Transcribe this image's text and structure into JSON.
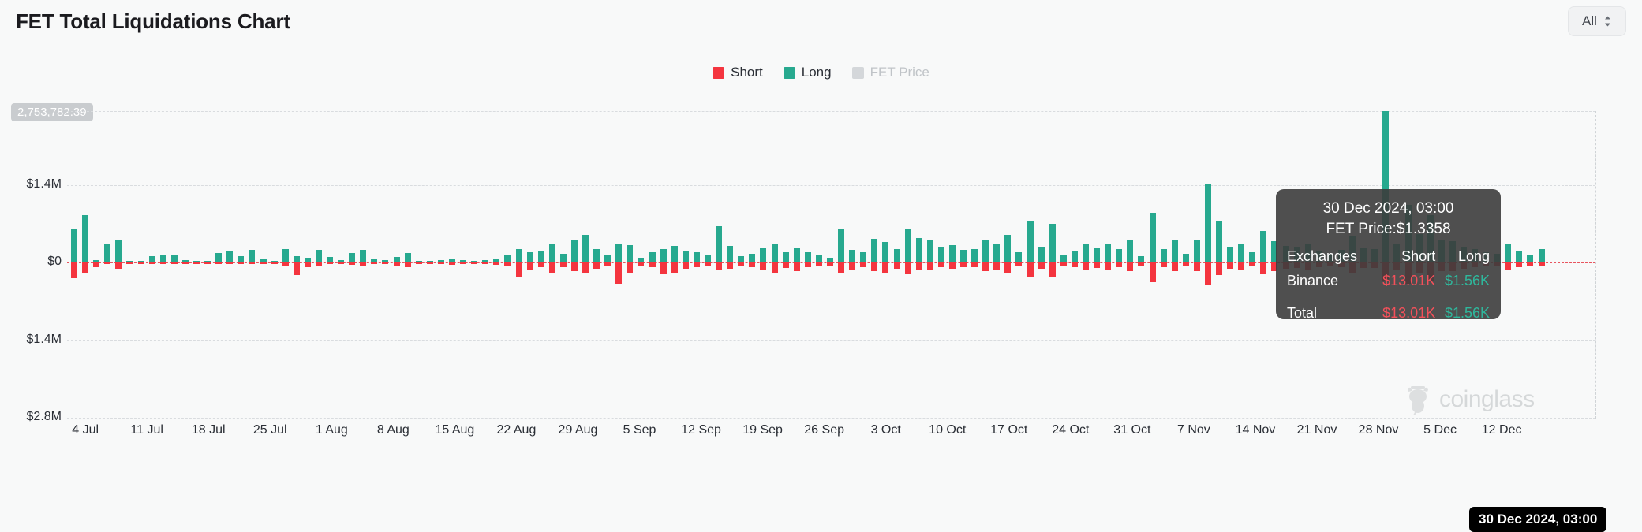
{
  "header": {
    "title": "FET Total Liquidations Chart",
    "range_selector": {
      "value": "All",
      "icon": "stepper-icon"
    }
  },
  "legend": [
    {
      "label": "Short",
      "color": "#f4353f",
      "disabled": false
    },
    {
      "label": "Long",
      "color": "#27a98f",
      "disabled": false
    },
    {
      "label": "FET Price",
      "color": "#d4d7da",
      "disabled": true
    }
  ],
  "y_badge": "2,753,782.39",
  "watermark": "coinglass",
  "crosshair_label": "30 Dec 2024, 03:00",
  "tooltip": {
    "date": "30 Dec 2024, 03:00",
    "price_line": "FET Price:$1.3358",
    "columns": [
      "Exchanges",
      "Short",
      "Long"
    ],
    "rows": [
      {
        "exchange": "Binance",
        "short": "$13.01K",
        "long": "$1.56K"
      },
      {
        "exchange": "Total",
        "short": "$13.01K",
        "long": "$1.56K"
      }
    ]
  },
  "chart_data": {
    "type": "bar",
    "title": "FET Total Liquidations Chart",
    "xlabel": "",
    "ylabel": "",
    "stacked": true,
    "grid": true,
    "legend_position": "top-center",
    "ylim": [
      -2800000,
      2753782.39
    ],
    "yticks": [
      1400000,
      0,
      -1400000,
      -2800000
    ],
    "ytick_labels": [
      "$1.4M",
      "$0",
      "$1.4M",
      "$2.8M"
    ],
    "ytop_annotation": "2,753,782.39",
    "xticks": [
      "4 Jul",
      "11 Jul",
      "18 Jul",
      "25 Jul",
      "1 Aug",
      "8 Aug",
      "15 Aug",
      "22 Aug",
      "29 Aug",
      "5 Sep",
      "12 Sep",
      "19 Sep",
      "26 Sep",
      "3 Oct",
      "10 Oct",
      "17 Oct",
      "24 Oct",
      "31 Oct",
      "7 Nov",
      "14 Nov",
      "21 Nov",
      "28 Nov",
      "5 Dec",
      "12 Dec"
    ],
    "series": [
      {
        "name": "Long",
        "color": "#27a98f",
        "values": [
          620000,
          860000,
          40000,
          330000,
          400000,
          18000,
          10000,
          120000,
          150000,
          130000,
          40000,
          20000,
          25000,
          170000,
          200000,
          110000,
          230000,
          60000,
          30000,
          250000,
          120000,
          80000,
          230000,
          100000,
          40000,
          170000,
          230000,
          60000,
          50000,
          100000,
          170000,
          30000,
          25000,
          40000,
          60000,
          50000,
          35000,
          40000,
          60000,
          130000,
          240000,
          180000,
          220000,
          330000,
          160000,
          420000,
          500000,
          250000,
          140000,
          330000,
          320000,
          90000,
          180000,
          240000,
          300000,
          210000,
          180000,
          130000,
          660000,
          300000,
          120000,
          160000,
          260000,
          330000,
          190000,
          260000,
          180000,
          140000,
          90000,
          610000,
          230000,
          180000,
          430000,
          380000,
          250000,
          600000,
          440000,
          410000,
          280000,
          320000,
          230000,
          240000,
          410000,
          330000,
          500000,
          190000,
          750000,
          290000,
          700000,
          150000,
          200000,
          340000,
          260000,
          330000,
          240000,
          420000,
          120000,
          900000,
          240000,
          420000,
          160000,
          420000,
          1420000,
          760000,
          280000,
          330000,
          180000,
          570000,
          390000,
          300000,
          270000,
          350000,
          210000,
          160000,
          230000,
          480000,
          260000,
          250000,
          2753782,
          330000,
          1050000,
          520000,
          860000,
          410000,
          390000,
          290000,
          240000,
          180000,
          160000,
          330000,
          210000,
          140000,
          240000
        ]
      },
      {
        "name": "Short",
        "color": "#f4353f",
        "values": [
          -290000,
          -180000,
          -90000,
          -20000,
          -120000,
          -15000,
          -10000,
          -18000,
          -15000,
          -14000,
          -12000,
          -10000,
          -8000,
          -20000,
          -16000,
          -12000,
          -30000,
          -10000,
          -8000,
          -60000,
          -230000,
          -90000,
          -60000,
          -30000,
          -20000,
          -40000,
          -70000,
          -30000,
          -25000,
          -60000,
          -90000,
          -20000,
          -18000,
          -30000,
          -40000,
          -30000,
          -25000,
          -30000,
          -40000,
          -60000,
          -250000,
          -140000,
          -90000,
          -180000,
          -80000,
          -160000,
          -200000,
          -120000,
          -60000,
          -390000,
          -180000,
          -50000,
          -90000,
          -210000,
          -180000,
          -120000,
          -90000,
          -70000,
          -130000,
          -120000,
          -60000,
          -90000,
          -130000,
          -180000,
          -100000,
          -160000,
          -90000,
          -70000,
          -50000,
          -200000,
          -130000,
          -90000,
          -150000,
          -180000,
          -120000,
          -210000,
          -140000,
          -130000,
          -90000,
          -120000,
          -80000,
          -90000,
          -160000,
          -130000,
          -190000,
          -70000,
          -260000,
          -110000,
          -250000,
          -60000,
          -80000,
          -140000,
          -100000,
          -130000,
          -90000,
          -160000,
          -50000,
          -360000,
          -90000,
          -160000,
          -60000,
          -160000,
          -400000,
          -230000,
          -110000,
          -130000,
          -70000,
          -210000,
          -150000,
          -120000,
          -100000,
          -130000,
          -80000,
          -60000,
          -90000,
          -180000,
          -100000,
          -95000,
          -330000,
          -130000,
          -390000,
          -200000,
          -330000,
          -160000,
          -150000,
          -110000,
          -90000,
          -70000,
          -60000,
          -130000,
          -80000,
          -55000,
          -60000
        ]
      }
    ]
  }
}
